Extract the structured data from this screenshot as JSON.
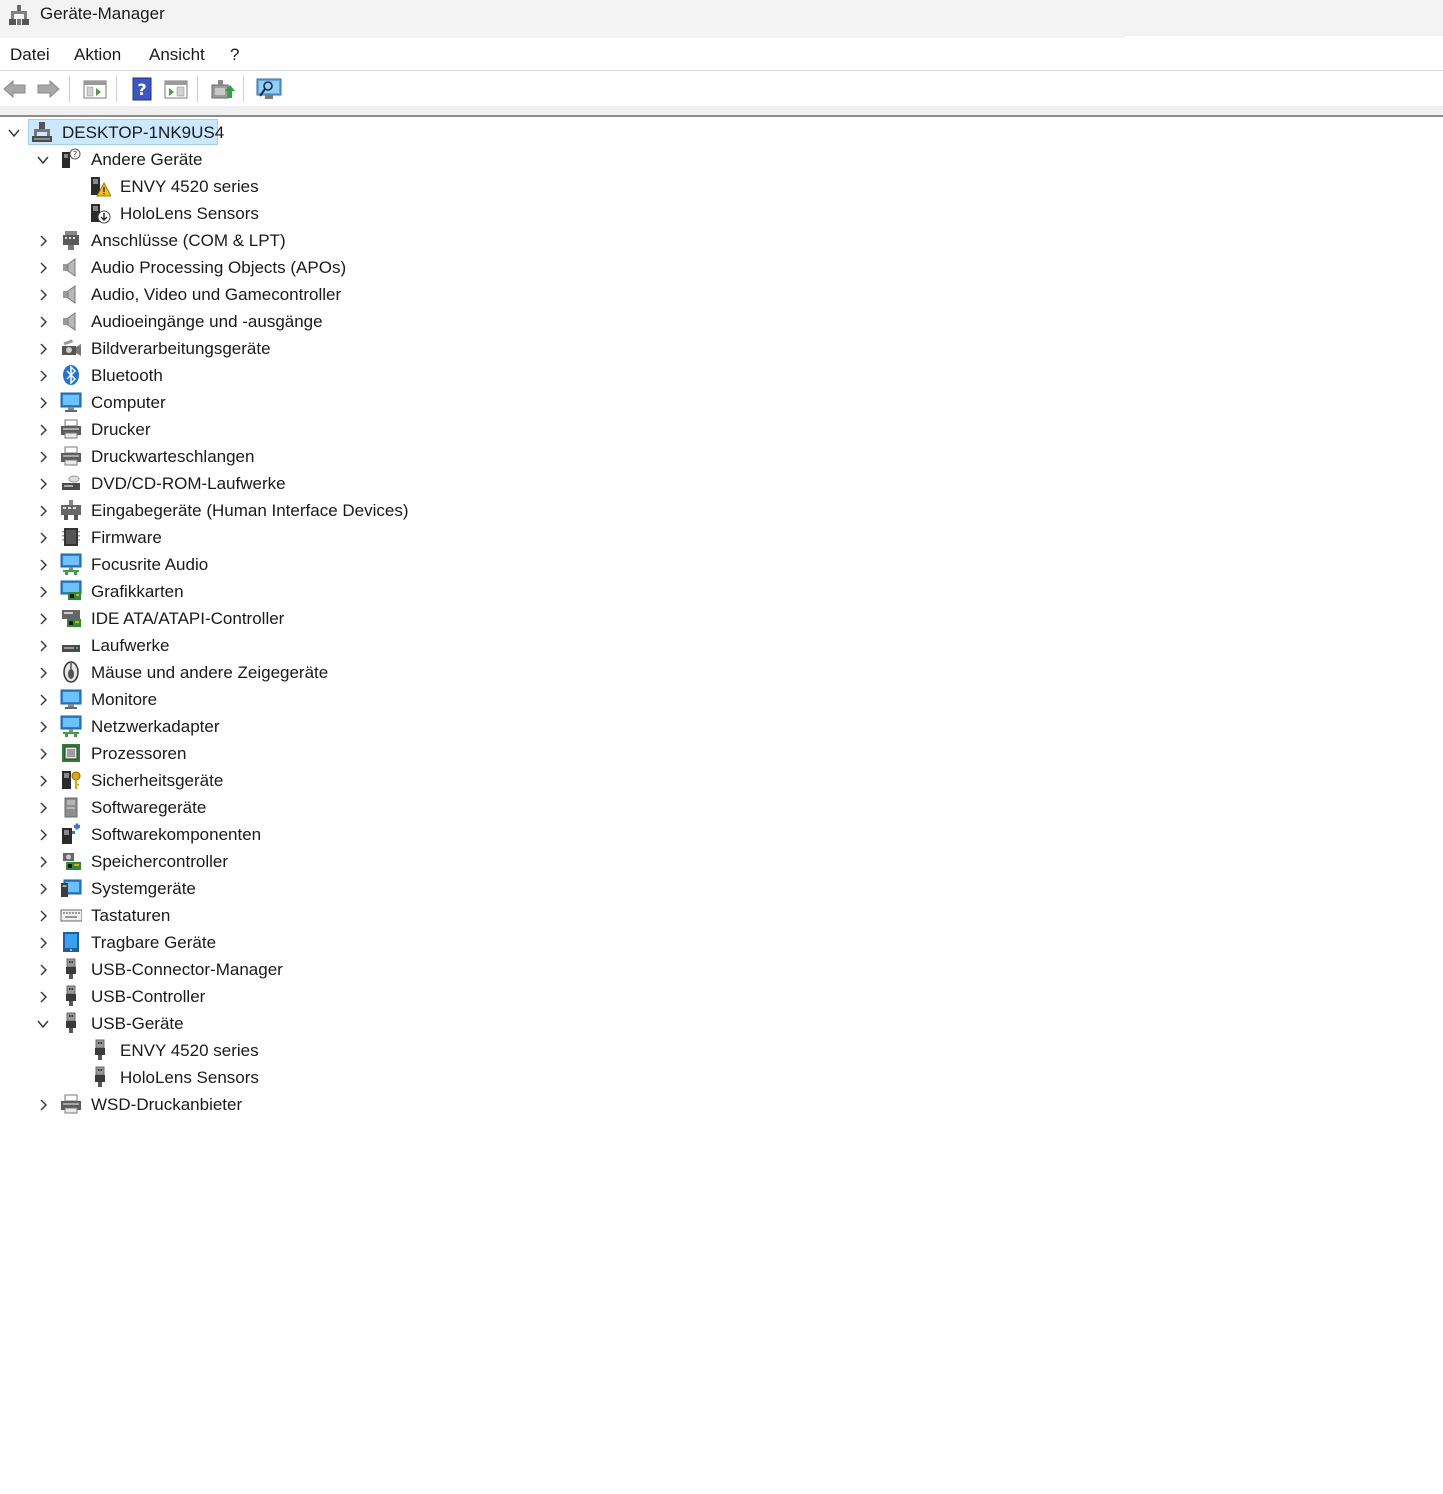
{
  "window": {
    "title": "Geräte-Manager"
  },
  "menu": [
    "Datei",
    "Aktion",
    "Ansicht",
    "?"
  ],
  "toolbar": [
    {
      "name": "back-arrow-icon"
    },
    {
      "name": "forward-arrow-icon"
    },
    {
      "name": "show-hide-console-tree-icon"
    },
    {
      "name": "help-icon"
    },
    {
      "name": "properties-pane-icon"
    },
    {
      "name": "update-driver-icon"
    },
    {
      "name": "scan-hardware-changes-icon"
    }
  ],
  "tree": {
    "root": {
      "label": "DESKTOP-1NK9US4",
      "expanded": true,
      "icon": "computer-network-icon"
    },
    "nodes": [
      {
        "label": "Andere Geräte",
        "expanded": true,
        "icon": "unknown-device-icon",
        "children": [
          {
            "label": "ENVY 4520 series",
            "icon": "warning-device-icon"
          },
          {
            "label": "HoloLens Sensors",
            "icon": "disabled-device-icon"
          }
        ]
      },
      {
        "label": "Anschlüsse (COM & LPT)",
        "expanded": false,
        "icon": "port-icon"
      },
      {
        "label": "Audio Processing Objects (APOs)",
        "expanded": false,
        "icon": "speaker-icon"
      },
      {
        "label": "Audio, Video und Gamecontroller",
        "expanded": false,
        "icon": "speaker-icon"
      },
      {
        "label": "Audioeingänge und -ausgänge",
        "expanded": false,
        "icon": "speaker-icon"
      },
      {
        "label": "Bildverarbeitungsgeräte",
        "expanded": false,
        "icon": "camera-icon"
      },
      {
        "label": "Bluetooth",
        "expanded": false,
        "icon": "bluetooth-icon"
      },
      {
        "label": "Computer",
        "expanded": false,
        "icon": "monitor-icon"
      },
      {
        "label": "Drucker",
        "expanded": false,
        "icon": "printer-icon"
      },
      {
        "label": "Druckwarteschlangen",
        "expanded": false,
        "icon": "printer-icon"
      },
      {
        "label": "DVD/CD-ROM-Laufwerke",
        "expanded": false,
        "icon": "disc-drive-icon"
      },
      {
        "label": "Eingabegeräte (Human Interface Devices)",
        "expanded": false,
        "icon": "hid-icon"
      },
      {
        "label": "Firmware",
        "expanded": false,
        "icon": "firmware-chip-icon"
      },
      {
        "label": "Focusrite Audio",
        "expanded": false,
        "icon": "network-monitor-icon"
      },
      {
        "label": "Grafikkarten",
        "expanded": false,
        "icon": "display-adapter-icon"
      },
      {
        "label": "IDE ATA/ATAPI-Controller",
        "expanded": false,
        "icon": "ide-controller-icon"
      },
      {
        "label": "Laufwerke",
        "expanded": false,
        "icon": "drive-icon"
      },
      {
        "label": "Mäuse und andere Zeigegeräte",
        "expanded": false,
        "icon": "mouse-icon"
      },
      {
        "label": "Monitore",
        "expanded": false,
        "icon": "monitor-icon"
      },
      {
        "label": "Netzwerkadapter",
        "expanded": false,
        "icon": "network-monitor-icon"
      },
      {
        "label": "Prozessoren",
        "expanded": false,
        "icon": "processor-icon"
      },
      {
        "label": "Sicherheitsgeräte",
        "expanded": false,
        "icon": "security-key-icon"
      },
      {
        "label": "Softwaregeräte",
        "expanded": false,
        "icon": "software-device-icon"
      },
      {
        "label": "Softwarekomponenten",
        "expanded": false,
        "icon": "software-component-icon"
      },
      {
        "label": "Speichercontroller",
        "expanded": false,
        "icon": "storage-controller-icon"
      },
      {
        "label": "Systemgeräte",
        "expanded": false,
        "icon": "system-device-icon"
      },
      {
        "label": "Tastaturen",
        "expanded": false,
        "icon": "keyboard-icon"
      },
      {
        "label": "Tragbare Geräte",
        "expanded": false,
        "icon": "portable-device-icon"
      },
      {
        "label": "USB-Connector-Manager",
        "expanded": false,
        "icon": "usb-icon"
      },
      {
        "label": "USB-Controller",
        "expanded": false,
        "icon": "usb-icon"
      },
      {
        "label": "USB-Geräte",
        "expanded": true,
        "icon": "usb-icon",
        "children": [
          {
            "label": "ENVY 4520 series",
            "icon": "usb-icon"
          },
          {
            "label": "HoloLens Sensors",
            "icon": "usb-icon"
          }
        ]
      },
      {
        "label": "WSD-Druckanbieter",
        "expanded": false,
        "icon": "printer-icon"
      }
    ]
  }
}
